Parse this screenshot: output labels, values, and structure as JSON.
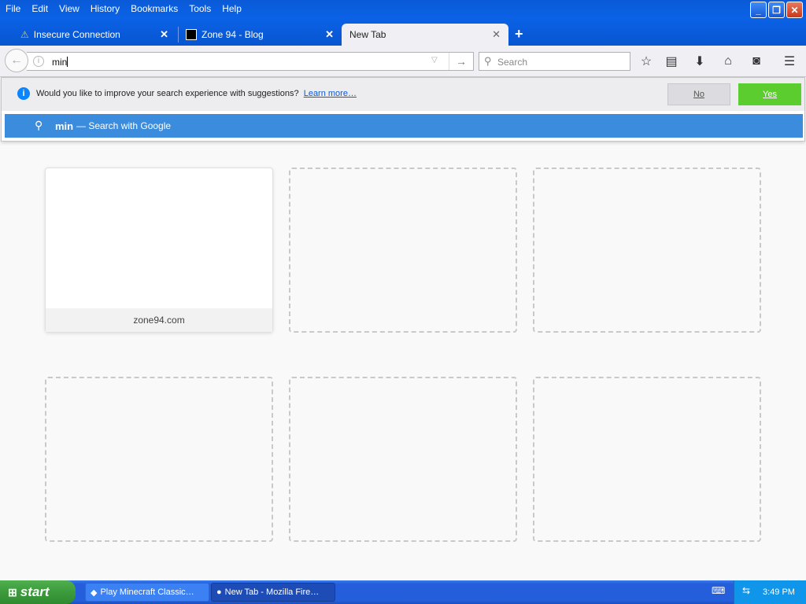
{
  "menu": [
    "File",
    "Edit",
    "View",
    "History",
    "Bookmarks",
    "Tools",
    "Help"
  ],
  "tabs": [
    {
      "label": "Insecure Connection",
      "icon": "warning-icon"
    },
    {
      "label": "Zone 94 - Blog",
      "icon": "site-favicon"
    },
    {
      "label": "New Tab",
      "icon": ""
    }
  ],
  "url": {
    "value": "min"
  },
  "search": {
    "placeholder": "Search"
  },
  "suggest": {
    "question": "Would you like to improve your search experience with suggestions?",
    "learn_more": "Learn more…",
    "no": "No",
    "yes": "Yes",
    "row_query": "min",
    "row_action": "— Search with Google"
  },
  "tiles": [
    {
      "caption": "zone94.com"
    }
  ],
  "taskbar": {
    "start": "start",
    "tasks": [
      "Play Minecraft Classic…",
      "New Tab - Mozilla Fire…"
    ],
    "clock": "3:49 PM"
  },
  "colors": {
    "accent": "#3b8cdc",
    "yes": "#5ccd2e",
    "titlebar": "#0b62e6"
  }
}
